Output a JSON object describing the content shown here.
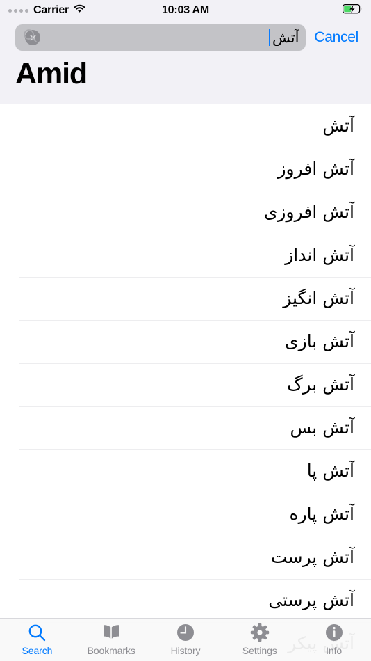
{
  "status_bar": {
    "carrier": "Carrier",
    "time": "10:03 AM",
    "signal_icon": "signal-dots-icon",
    "wifi_icon": "wifi-icon",
    "battery_icon": "battery-charging-icon",
    "battery_level_percent": 45
  },
  "search": {
    "value": "آتش",
    "placeholder": "",
    "search_icon": "search-icon",
    "clear_icon": "clear-text-icon",
    "cancel_label": "Cancel"
  },
  "header": {
    "title": "Amid"
  },
  "colors": {
    "accent": "#007aff",
    "header_bg": "#f2f1f6",
    "search_field_bg": "#c3c3c7",
    "inactive_tab": "#8e8e93",
    "separator": "#ededef",
    "battery_green": "#4cd964"
  },
  "results": [
    {
      "term": "آتش"
    },
    {
      "term": "آتش افروز"
    },
    {
      "term": "آتش افروزی"
    },
    {
      "term": "آتش انداز"
    },
    {
      "term": "آتش انگیز"
    },
    {
      "term": "آتش بازی"
    },
    {
      "term": "آتش برگ"
    },
    {
      "term": "آتش بس"
    },
    {
      "term": "آتش پا"
    },
    {
      "term": "آتش پاره"
    },
    {
      "term": "آتش پرست"
    },
    {
      "term": "آتش پرستی"
    },
    {
      "term": "آتش پیکر"
    }
  ],
  "tab_bar": {
    "items": [
      {
        "label": "Search",
        "icon": "search-icon",
        "active": true
      },
      {
        "label": "Bookmarks",
        "icon": "book-icon",
        "active": false
      },
      {
        "label": "History",
        "icon": "clock-icon",
        "active": false
      },
      {
        "label": "Settings",
        "icon": "gear-icon",
        "active": false
      },
      {
        "label": "Info",
        "icon": "info-icon",
        "active": false
      }
    ]
  }
}
